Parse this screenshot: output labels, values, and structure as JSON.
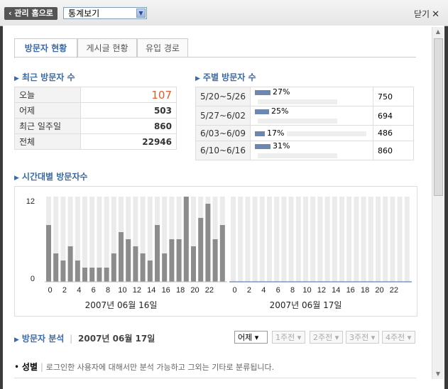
{
  "header": {
    "home_button": "관리 홈으로",
    "view_select": "통계보기",
    "close_label": "닫기"
  },
  "tabs": [
    "방문자 현황",
    "게시글 현황",
    "유입 경로"
  ],
  "recent_visitors": {
    "title": "최근 방문자 수",
    "rows": [
      {
        "label": "오늘",
        "value": "107"
      },
      {
        "label": "어제",
        "value": "503"
      },
      {
        "label": "최근 일주일",
        "value": "860"
      },
      {
        "label": "전체",
        "value": "22946"
      }
    ]
  },
  "weekly_visitors": {
    "title": "주별 방문자 수",
    "rows": [
      {
        "range": "5/20~5/26",
        "percent": "27%",
        "value": "750",
        "fraction": 0.27
      },
      {
        "range": "5/27~6/02",
        "percent": "25%",
        "value": "694",
        "fraction": 0.25
      },
      {
        "range": "6/03~6/09",
        "percent": "17%",
        "value": "486",
        "fraction": 0.17
      },
      {
        "range": "6/10~6/16",
        "percent": "31%",
        "value": "860",
        "fraction": 0.31
      }
    ]
  },
  "hourly": {
    "title": "시간대별 방문자수"
  },
  "chart_data": [
    {
      "type": "bar",
      "title": "2007년 06월 16일",
      "x": [
        0,
        1,
        2,
        3,
        4,
        5,
        6,
        7,
        8,
        9,
        10,
        11,
        12,
        13,
        14,
        15,
        16,
        17,
        18,
        19,
        20,
        21,
        22,
        23
      ],
      "x_tick_labels": [
        "0",
        "2",
        "4",
        "6",
        "8",
        "10",
        "12",
        "14",
        "16",
        "18",
        "20",
        "22"
      ],
      "y_tick_labels": [
        "12",
        "0"
      ],
      "ylim": [
        0,
        12
      ],
      "values": [
        8,
        4,
        3,
        5,
        3,
        2,
        2,
        2,
        2,
        4,
        7,
        6,
        5,
        4,
        3,
        8,
        4,
        6,
        6,
        12,
        5,
        9,
        11,
        6,
        8
      ]
    },
    {
      "type": "bar",
      "title": "2007년 06월 17일",
      "x": [
        0,
        1,
        2,
        3,
        4,
        5,
        6,
        7,
        8,
        9,
        10,
        11,
        12,
        13,
        14,
        15,
        16,
        17,
        18,
        19,
        20,
        21,
        22,
        23
      ],
      "x_tick_labels": [
        "0",
        "2",
        "4",
        "6",
        "8",
        "10",
        "12",
        "14",
        "16",
        "18",
        "20",
        "22"
      ],
      "ylim": [
        0,
        12
      ],
      "values": [
        0,
        0,
        0,
        0,
        0,
        0,
        0,
        0,
        0,
        0,
        0,
        0,
        0,
        0,
        0,
        0,
        0,
        0,
        0,
        0,
        0,
        0,
        0,
        0
      ]
    }
  ],
  "analysis": {
    "title": "방문자 분석",
    "date": "2007년 06월 17일",
    "selectors": [
      "어제",
      "1주전",
      "2주전",
      "3주전",
      "4주전"
    ],
    "gender_title": "성별",
    "gender_note": "로그인한 사용자에 대해서만 분석 가능하고 그외는 기타로 분류됩니다."
  }
}
